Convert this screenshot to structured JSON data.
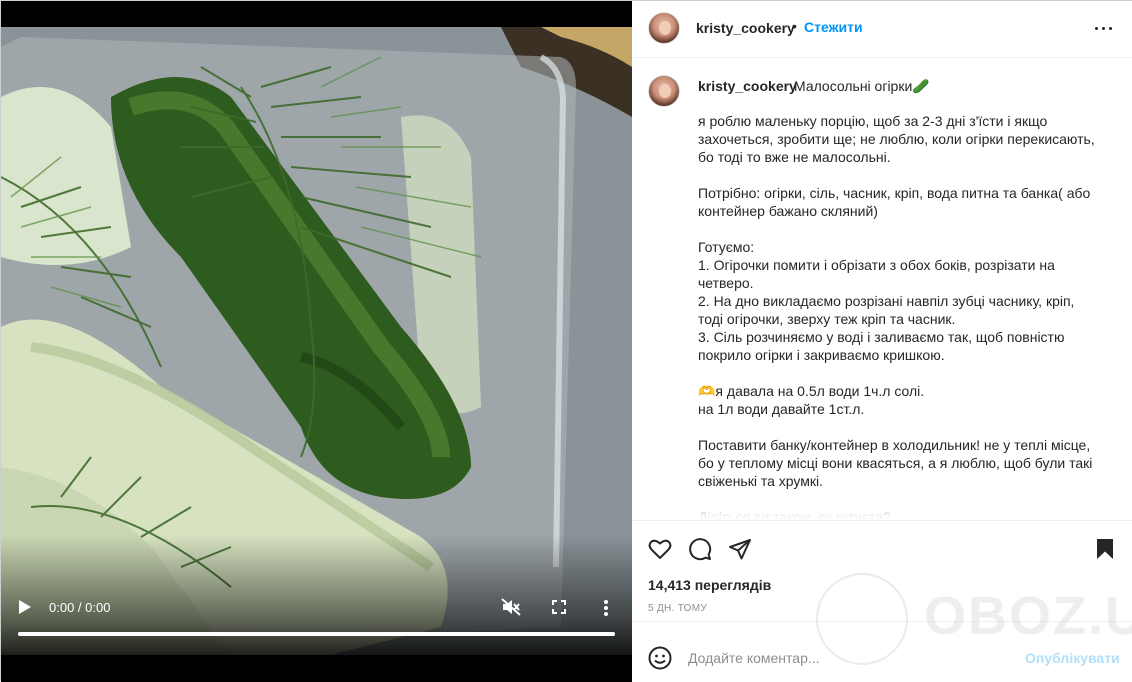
{
  "post": {
    "username": "kristy_cookery",
    "separator": "•",
    "follow_label": "Стежити",
    "caption_title": "Малосольні огірки🥒",
    "caption_lines": [
      [
        "я роблю маленьку порцію, щоб за 2-3 дні з'їсти і якщо",
        "захочеться, зробити ще; не люблю, коли огірки перекисають,",
        "бо тоді то вже не малосольні."
      ],
      [
        "Потрібно: огірки, сіль, часник, кріп, вода питна та банка( або",
        "контейнер бажано скляний)"
      ],
      [
        "Готуємо:",
        "1. Огірочки помити і обрізати з обох боків, розрізати на",
        "четверо.",
        "2. На дно викладаємо розрізані навпіл зубці часнику, кріп,",
        "тоді огірочки, зверху теж кріп та часник.",
        "3. Сіль розчиняємо у воді і заливаємо так, щоб повністю",
        "покрило огірки і закриваємо кришкою."
      ],
      [
        "🫶я давала на 0.5л води 1ч.л солі.",
        "на 1л води давайте 1ст.л."
      ],
      [
        "Поставити банку/контейнер в холодильник! не у теплі місце,",
        "бо у теплому місці вони квасяться, а я люблю, щоб були такі",
        "свіженькі та хрумкі."
      ],
      [
        "Діліться ви також, як готуєте?"
      ]
    ],
    "views": "14,413 переглядів",
    "time_ago": "5 дн. тому"
  },
  "video": {
    "time": "0:00 / 0:00",
    "progress": 1.0
  },
  "comment": {
    "placeholder": "Додайте коментар...",
    "post_label": "Опублікувати"
  },
  "watermark": {
    "text": "OBOZ.UA"
  },
  "icons": {
    "header_more": "more-horizontal-icon",
    "like": "heart-icon",
    "comment": "comment-icon",
    "share": "paper-plane-icon",
    "save": "bookmark-icon",
    "emoji": "smiley-icon",
    "play": "play-icon",
    "mute": "volume-muted-icon",
    "fullscreen": "fullscreen-icon",
    "video_more": "more-vertical-icon"
  },
  "colors": {
    "accent": "#0095f6",
    "post_disabled": "#b2dffc",
    "text": "#262626",
    "muted": "#8e8e8e"
  }
}
